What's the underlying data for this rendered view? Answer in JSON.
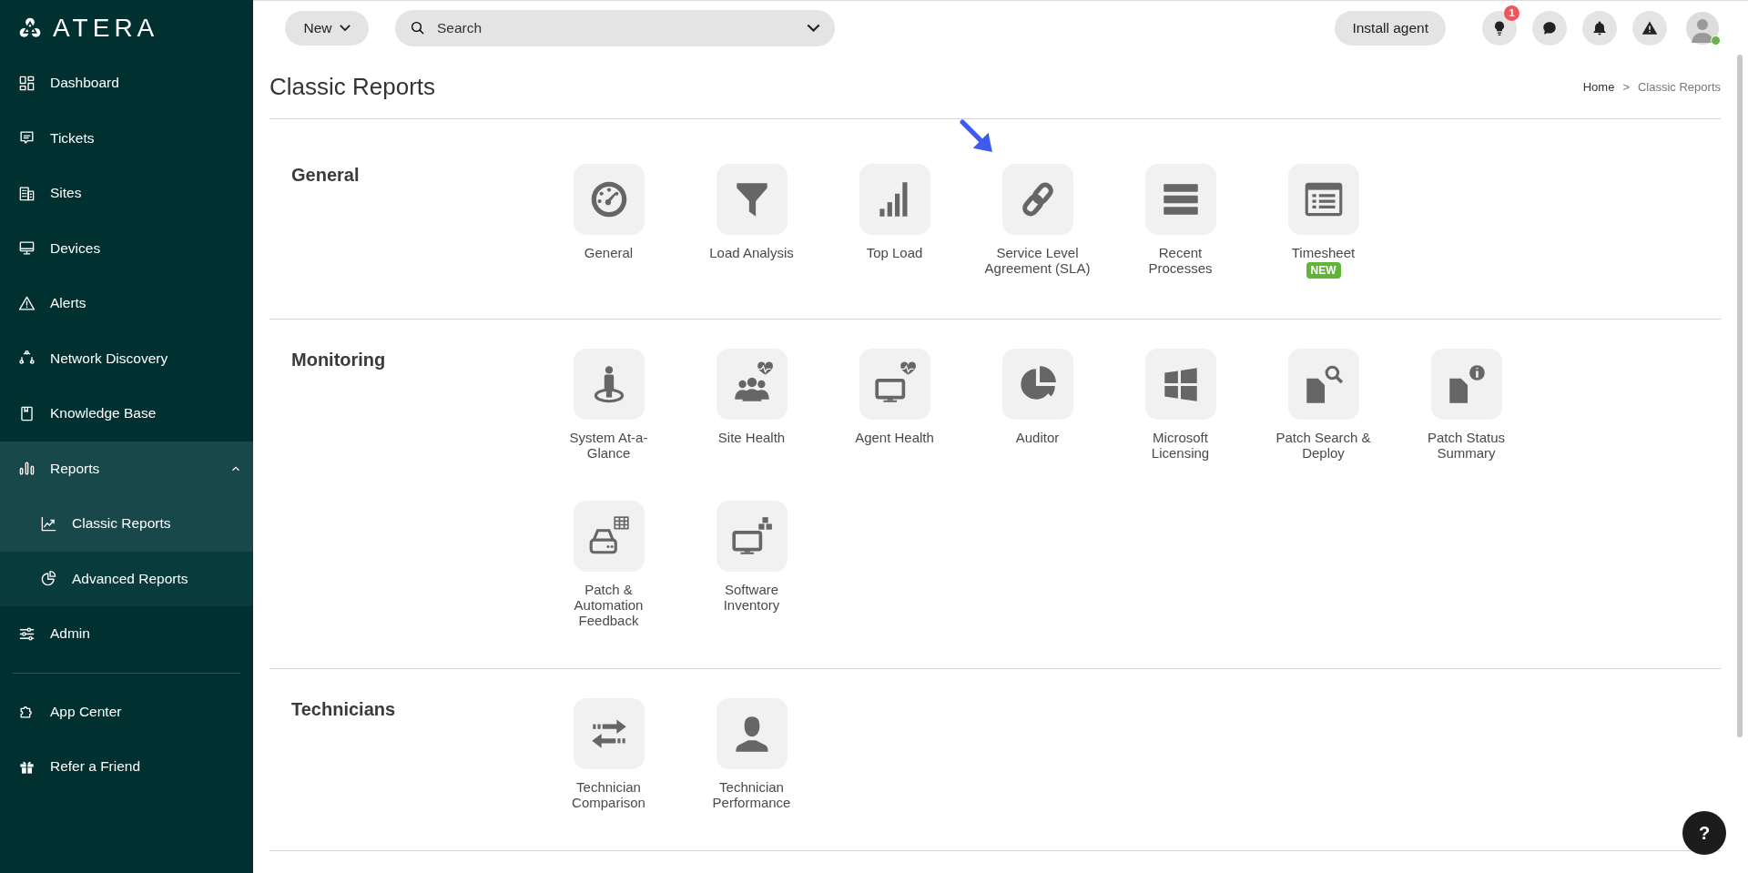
{
  "sidebar": {
    "logo_text": "ATERA",
    "items": [
      {
        "label": "Dashboard",
        "selected": false
      },
      {
        "label": "Tickets",
        "selected": false
      },
      {
        "label": "Sites",
        "selected": false
      },
      {
        "label": "Devices",
        "selected": false
      },
      {
        "label": "Alerts",
        "selected": false
      },
      {
        "label": "Network Discovery",
        "selected": false
      },
      {
        "label": "Knowledge Base",
        "selected": false
      },
      {
        "label": "Reports",
        "selected": false,
        "expanded": true,
        "children": [
          {
            "label": "Classic Reports",
            "selected": true
          },
          {
            "label": "Advanced Reports",
            "selected": false
          }
        ]
      },
      {
        "label": "Admin",
        "selected": false
      }
    ],
    "footer_items": [
      {
        "label": "App Center",
        "selected": false
      },
      {
        "label": "Refer a Friend",
        "selected": false
      }
    ]
  },
  "topbar": {
    "new_button": "New",
    "search": {
      "placeholder": "Search"
    },
    "install_button": "Install agent",
    "notification_badge": "1",
    "avatar": {
      "online": true
    }
  },
  "page": {
    "title": "Classic Reports",
    "breadcrumb": [
      "Home",
      "Classic Reports"
    ],
    "breadcrumb_separator": ">"
  },
  "sections": [
    {
      "title": "General",
      "reports": [
        {
          "label": "General"
        },
        {
          "label": "Load Analysis"
        },
        {
          "label": "Top Load"
        },
        {
          "label": "Service Level Agreement (SLA)"
        },
        {
          "label": "Recent Processes"
        },
        {
          "label": "Timesheet",
          "badge": "NEW"
        }
      ]
    },
    {
      "title": "Monitoring",
      "reports": [
        {
          "label": "System At-a-Glance"
        },
        {
          "label": "Site Health"
        },
        {
          "label": "Agent Health"
        },
        {
          "label": "Auditor"
        },
        {
          "label": "Microsoft Licensing"
        },
        {
          "label": "Patch Search & Deploy"
        },
        {
          "label": "Patch Status Summary"
        },
        {
          "label": "Patch & Automation Feedback"
        },
        {
          "label": "Software Inventory"
        }
      ]
    },
    {
      "title": "Technicians",
      "reports": [
        {
          "label": "Technician Comparison"
        },
        {
          "label": "Technician Performance"
        }
      ]
    }
  ],
  "help_button": "?"
}
